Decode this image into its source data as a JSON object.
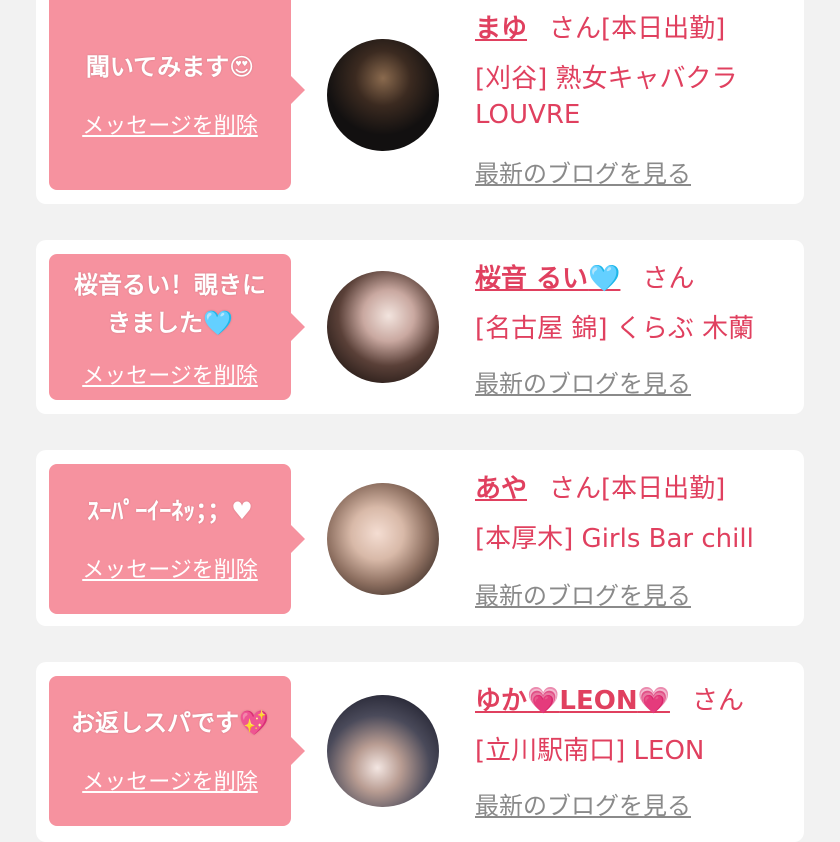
{
  "delete_label": "メッセージを削除",
  "blog_label": "最新のブログを見る",
  "honorific": "さん",
  "cards": [
    {
      "message_text": "聞いてみます",
      "message_emoji": "😍",
      "name": "まゆ",
      "status": "[本日出勤]",
      "location": "[刈谷] 熟女キャバクラ",
      "shop_extra": "LOUVRE",
      "avatar": "woman-photo"
    },
    {
      "message_line1": "桜音るい！覗きに",
      "message_line2": "きました",
      "message_emoji": "🩵",
      "name": "桜音 るい",
      "name_emoji": "🩵",
      "location": "[名古屋 錦] くらぶ 木蘭",
      "avatar": "woman-photo"
    },
    {
      "message_text": "ｽｰﾊﾟｰｲｰﾈｯ；；♥",
      "name": "あや",
      "status": "[本日出勤]",
      "location": "[本厚木] Girls Bar chill",
      "avatar": "woman-photo"
    },
    {
      "message_text": "お返しスパです",
      "message_emoji": "💖",
      "name": "ゆか",
      "name_emoji1": "💗",
      "name_mid": "LEON",
      "name_emoji2": "💗",
      "location": "[立川駅南口] LEON",
      "avatar": "woman-photo"
    }
  ]
}
